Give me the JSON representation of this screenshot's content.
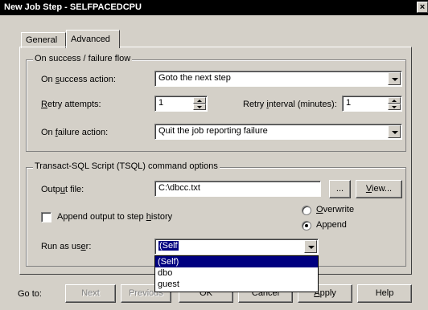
{
  "window": {
    "title": "New Job Step - SELFPACEDCPU",
    "close_glyph": "×"
  },
  "tabs": [
    {
      "label": "General"
    },
    {
      "label": "Advanced"
    }
  ],
  "flow_group": {
    "legend": "On success / failure flow",
    "success_action": {
      "label_pre": "On ",
      "label_u": "s",
      "label_post": "uccess action:",
      "value": "Goto the next step"
    },
    "retry": {
      "label_u": "R",
      "label_post": "etry attempts:",
      "value": "1"
    },
    "retry_interval": {
      "label_pre": "Retry ",
      "label_u": "i",
      "label_post": "nterval (minutes):",
      "value": "1"
    },
    "failure_action": {
      "label_pre": "On ",
      "label_u": "f",
      "label_post": "ailure action:",
      "value": "Quit the job reporting failure"
    }
  },
  "tsql_group": {
    "legend": "Transact-SQL Script (TSQL) command options",
    "output_file": {
      "label_pre": "Outp",
      "label_u": "u",
      "label_post": "t file:",
      "value": "C:\\dbcc.txt"
    },
    "browse_label": "...",
    "view": {
      "label_u": "V",
      "label_post": "iew..."
    },
    "append_history": {
      "label_pre": "Append output to step ",
      "label_u": "h",
      "label_post": "istory",
      "checked": false
    },
    "overwrite": {
      "label_u": "O",
      "label_post": "verwrite",
      "selected": false
    },
    "append": {
      "label": "Append",
      "selected": true
    },
    "run_as": {
      "label_pre": "Run as us",
      "label_u": "e",
      "label_post": "r:",
      "value": "(Self"
    },
    "options": [
      "(Self)",
      "dbo",
      "guest"
    ]
  },
  "footer": {
    "goto_label": "Go to:",
    "next": "Next",
    "previous": "Previous",
    "ok": "OK",
    "cancel": "Cancel",
    "apply": {
      "label_u": "A",
      "label_post": "pply"
    },
    "help": "Help"
  }
}
